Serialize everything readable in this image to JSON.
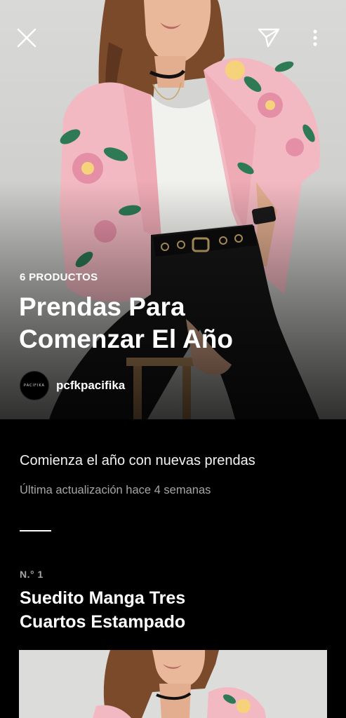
{
  "header": {
    "close_icon": "close-icon",
    "share_icon": "paper-plane-icon",
    "more_icon": "more-vertical-icon"
  },
  "collection": {
    "product_count": "6 PRODUCTOS",
    "title_line1": "Prendas Para",
    "title_line2": "Comenzar El Año",
    "author": {
      "avatar_text": "PACIFIKA",
      "username": "pcfkpacifika"
    },
    "description": "Comienza el año con nuevas prendas",
    "updated": "Última actualización hace 4 semanas"
  },
  "item": {
    "number": "N.° 1",
    "title_line1": "Suedito Manga Tres",
    "title_line2": "Cuartos Estampado"
  },
  "colors": {
    "background": "#000000",
    "text_primary": "#ffffff",
    "text_secondary": "#a6a6a6"
  }
}
